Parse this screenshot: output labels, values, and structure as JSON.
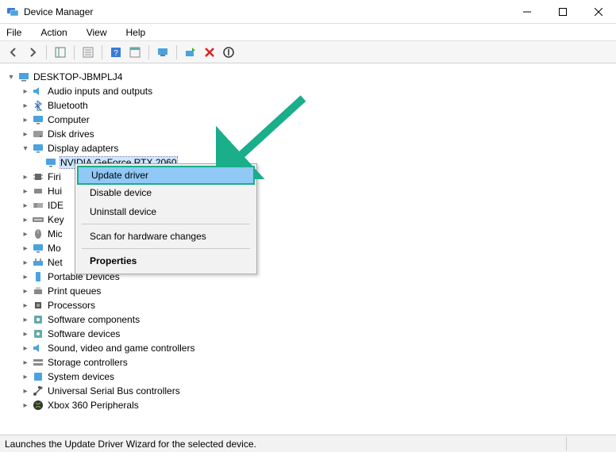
{
  "title": "Device Manager",
  "menubar": [
    "File",
    "Action",
    "View",
    "Help"
  ],
  "tree": {
    "root": "DESKTOP-JBMPLJ4",
    "categories": [
      {
        "label": "Audio inputs and outputs",
        "icon": "speaker"
      },
      {
        "label": "Bluetooth",
        "icon": "bluetooth"
      },
      {
        "label": "Computer",
        "icon": "monitor"
      },
      {
        "label": "Disk drives",
        "icon": "disk"
      },
      {
        "label": "Display adapters",
        "icon": "monitor",
        "expanded": true,
        "children": [
          {
            "label": "NVIDIA GeForce RTX 2060",
            "icon": "monitor",
            "selected": true
          }
        ]
      },
      {
        "label": "Firmware_trunc",
        "display": "Firi",
        "icon": "chip"
      },
      {
        "label": "HID_trunc",
        "display": "Hui",
        "icon": "hid"
      },
      {
        "label": "IDE_trunc",
        "display": "IDE",
        "icon": "ide"
      },
      {
        "label": "Keyboards_trunc",
        "display": "Key",
        "icon": "keyboard"
      },
      {
        "label": "Mice_trunc",
        "display": "Mic",
        "icon": "mouse"
      },
      {
        "label": "Monitors_trunc",
        "display": "Mo",
        "icon": "monitor"
      },
      {
        "label": "Network_trunc",
        "display": "Net",
        "icon": "network"
      },
      {
        "label": "Portable Devices",
        "icon": "portable"
      },
      {
        "label": "Print queues",
        "icon": "printer"
      },
      {
        "label": "Processors",
        "icon": "cpu"
      },
      {
        "label": "Software components",
        "icon": "software"
      },
      {
        "label": "Software devices",
        "icon": "software"
      },
      {
        "label": "Sound, video and game controllers",
        "icon": "speaker"
      },
      {
        "label": "Storage controllers",
        "icon": "storage"
      },
      {
        "label": "System devices",
        "icon": "system"
      },
      {
        "label": "Universal Serial Bus controllers",
        "icon": "usb"
      },
      {
        "label": "Xbox 360 Peripherals",
        "icon": "xbox"
      }
    ]
  },
  "context_menu": {
    "items": [
      {
        "label": "Update driver",
        "highlight": true
      },
      {
        "label": "Disable device"
      },
      {
        "label": "Uninstall device"
      },
      {
        "sep": true
      },
      {
        "label": "Scan for hardware changes"
      },
      {
        "sep": true
      },
      {
        "label": "Properties",
        "bold": true
      }
    ]
  },
  "statusbar": "Launches the Update Driver Wizard for the selected device."
}
